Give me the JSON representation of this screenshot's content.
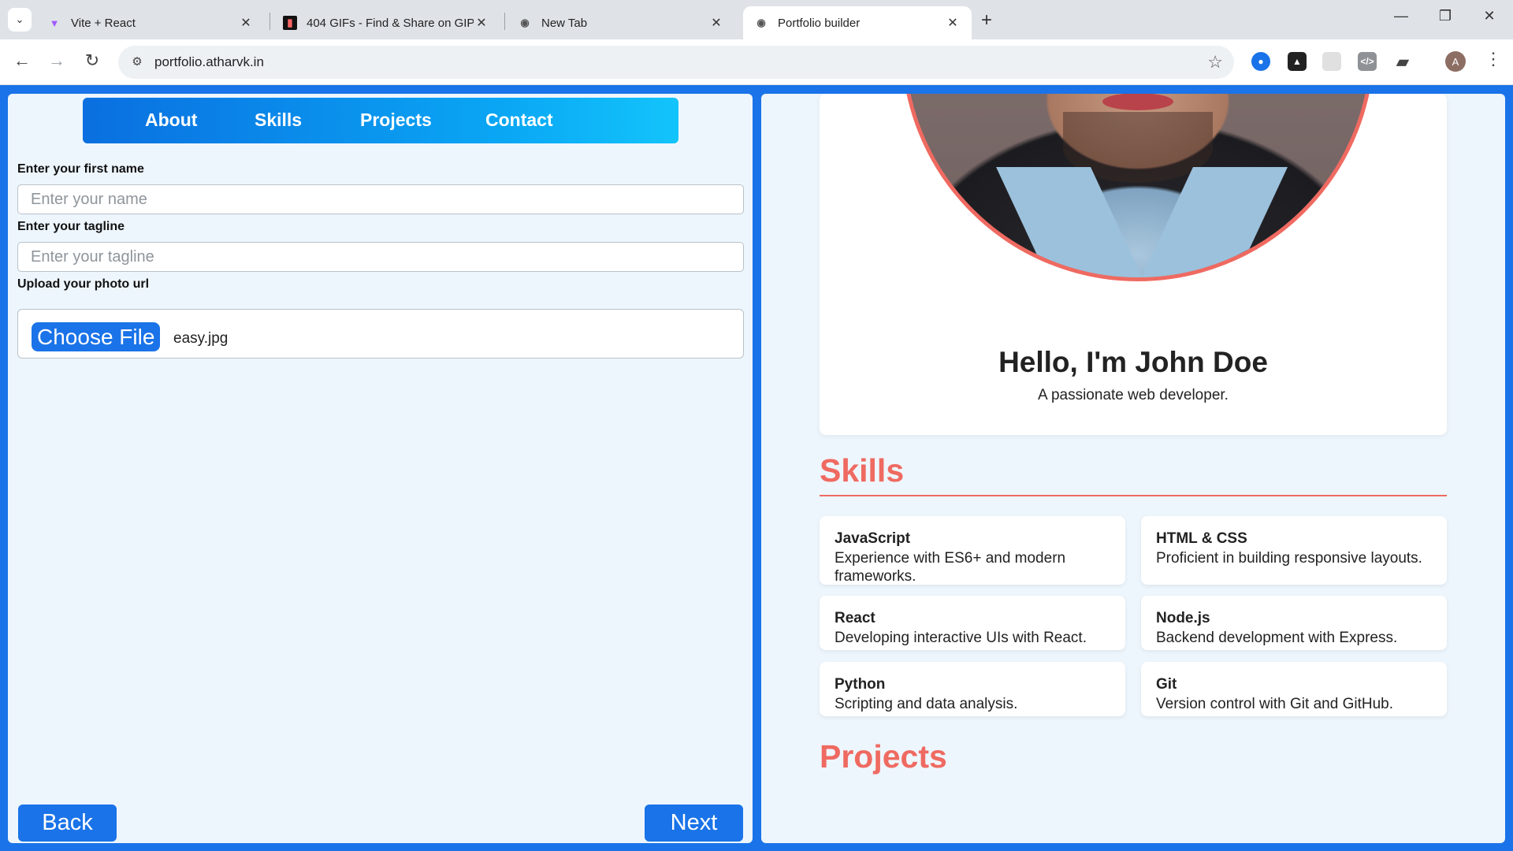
{
  "browser": {
    "tabs": [
      {
        "title": "Vite + React",
        "icon": "vite-icon",
        "active": false
      },
      {
        "title": "404 GIFs - Find & Share on GIPHY",
        "icon": "giphy-icon",
        "active": false
      },
      {
        "title": "New Tab",
        "icon": "chrome-icon",
        "active": false
      },
      {
        "title": "Portfolio builder",
        "icon": "globe-icon",
        "active": true
      }
    ],
    "url": "portfolio.atharvk.in",
    "profile_initial": "A"
  },
  "nav": {
    "items": [
      "About",
      "Skills",
      "Projects",
      "Contact"
    ]
  },
  "form": {
    "first_name_label": "Enter your first name",
    "first_name_placeholder": "Enter your name",
    "first_name_value": "",
    "tagline_label": "Enter your tagline",
    "tagline_placeholder": "Enter your tagline",
    "tagline_value": "",
    "photo_label": "Upload your photo url",
    "choose_file_label": "Choose File",
    "file_name": "easy.jpg",
    "back_label": "Back",
    "next_label": "Next"
  },
  "preview": {
    "hero_name": "Hello, I'm John Doe",
    "hero_tagline": "A passionate web developer.",
    "skills_title": "Skills",
    "skills": [
      {
        "name": "JavaScript",
        "desc": "Experience with ES6+ and modern frameworks."
      },
      {
        "name": "HTML & CSS",
        "desc": "Proficient in building responsive layouts."
      },
      {
        "name": "React",
        "desc": "Developing interactive UIs with React."
      },
      {
        "name": "Node.js",
        "desc": "Backend development with Express."
      },
      {
        "name": "Python",
        "desc": "Scripting and data analysis."
      },
      {
        "name": "Git",
        "desc": "Version control with Git and GitHub."
      }
    ],
    "projects_title": "Projects"
  },
  "colors": {
    "primary": "#1a73e8",
    "accent": "#ef6a61",
    "panel_bg": "#eef6fd"
  }
}
